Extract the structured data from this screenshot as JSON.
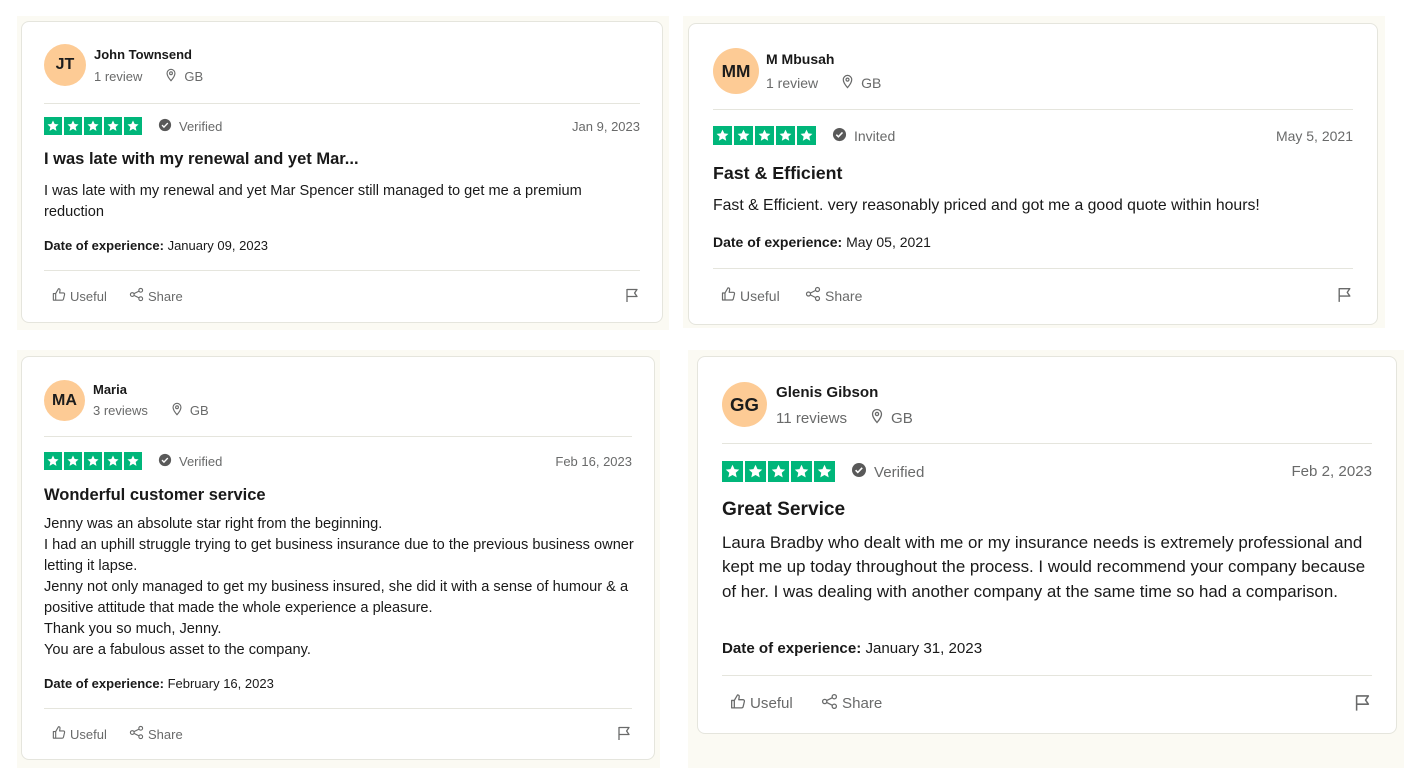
{
  "theme": {
    "star_green": "#00b67a",
    "avatar_bg": "#fdcb95",
    "muted_text": "#696a6a"
  },
  "icons": [
    "star-icon",
    "location-pin-icon",
    "check-circle-icon",
    "thumbs-up-icon",
    "share-icon",
    "flag-icon"
  ],
  "reviews": [
    {
      "initials": "JT",
      "name": "John Townsend",
      "review_count": "1 review",
      "country": "GB",
      "rating": 5,
      "status": "Verified",
      "date": "Jan 9, 2023",
      "title": "I was late with my renewal and yet Mar...",
      "body": [
        "I was late with my renewal and yet Mar Spencer still managed to get me a premium reduction"
      ],
      "experience_label": "Date of experience:",
      "experience_date": "January 09, 2023",
      "useful_label": "Useful",
      "share_label": "Share"
    },
    {
      "initials": "MM",
      "name": "M Mbusah",
      "review_count": "1 review",
      "country": "GB",
      "rating": 5,
      "status": "Invited",
      "date": "May 5, 2021",
      "title": "Fast & Efficient",
      "body": [
        "Fast & Efficient. very reasonably priced and got me a good quote within hours!"
      ],
      "experience_label": "Date of experience:",
      "experience_date": "May 05, 2021",
      "useful_label": "Useful",
      "share_label": "Share"
    },
    {
      "initials": "MA",
      "name": "Maria",
      "review_count": "3 reviews",
      "country": "GB",
      "rating": 5,
      "status": "Verified",
      "date": "Feb 16, 2023",
      "title": "Wonderful customer service",
      "body": [
        "Jenny was an absolute star right from the beginning.",
        "I had an uphill struggle trying to get business insurance due to the previous business owner letting it lapse.",
        "Jenny not only managed to get my business insured, she did it with a sense of humour & a positive attitude that made the whole experience a pleasure.",
        "Thank you so much, Jenny.",
        "You are a fabulous asset to the company."
      ],
      "experience_label": "Date of experience:",
      "experience_date": "February 16, 2023",
      "useful_label": "Useful",
      "share_label": "Share"
    },
    {
      "initials": "GG",
      "name": "Glenis Gibson",
      "review_count": "11 reviews",
      "country": "GB",
      "rating": 5,
      "status": "Verified",
      "date": "Feb 2, 2023",
      "title": "Great Service",
      "body": [
        "Laura Bradby who dealt with me or my insurance needs is extremely professional and kept me up today throughout the process. I would recommend your company because of her. I was dealing with another company at the same time so had a comparison."
      ],
      "experience_label": "Date of experience:",
      "experience_date": "January 31, 2023",
      "useful_label": "Useful",
      "share_label": "Share"
    }
  ]
}
